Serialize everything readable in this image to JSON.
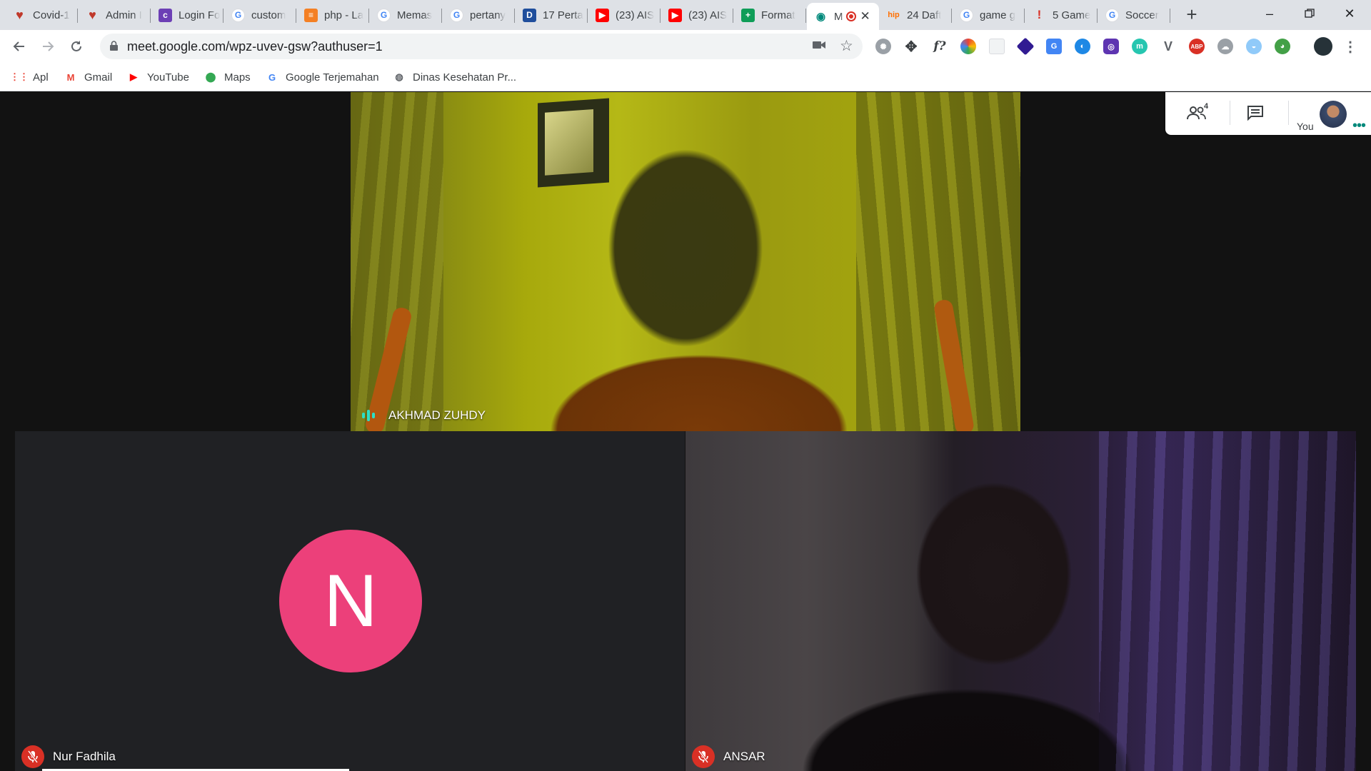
{
  "tabs": [
    {
      "title": "Covid-1",
      "icon": "heart-icon",
      "color": "#c0392b",
      "glyph": "♥"
    },
    {
      "title": "Admin I",
      "icon": "heart-icon",
      "color": "#c0392b",
      "glyph": "♥"
    },
    {
      "title": "Login Fo",
      "icon": "colorlib-icon",
      "color": "#6c3fb5",
      "glyph": "c"
    },
    {
      "title": "custom",
      "icon": "google-icon",
      "color": "#4285f4",
      "glyph": "G"
    },
    {
      "title": "php - La",
      "icon": "stackoverflow-icon",
      "color": "#f48024",
      "glyph": "≡"
    },
    {
      "title": "Memas",
      "icon": "google-icon",
      "color": "#4285f4",
      "glyph": "G"
    },
    {
      "title": "pertany",
      "icon": "google-icon",
      "color": "#4285f4",
      "glyph": "G"
    },
    {
      "title": "17 Perta",
      "icon": "d-icon",
      "color": "#1f4e9c",
      "glyph": "D"
    },
    {
      "title": "(23) AIS",
      "icon": "youtube-icon",
      "color": "#ff0000",
      "glyph": "▶"
    },
    {
      "title": "(23) AIS",
      "icon": "youtube-icon",
      "color": "#ff0000",
      "glyph": "▶"
    },
    {
      "title": "Format",
      "icon": "sheets-icon",
      "color": "#0f9d58",
      "glyph": "+"
    },
    {
      "title": "M",
      "icon": "meet-icon",
      "color": "#00897b",
      "glyph": "◉",
      "active": true
    },
    {
      "title": "24 Daft",
      "icon": "hip-icon",
      "color": "#ff6f00",
      "glyph": "hip"
    },
    {
      "title": "game g",
      "icon": "google-icon",
      "color": "#4285f4",
      "glyph": "G"
    },
    {
      "title": "5 Game",
      "icon": "exclamation-icon",
      "color": "#d93025",
      "glyph": "!"
    },
    {
      "title": "Soccer",
      "icon": "google-icon",
      "color": "#4285f4",
      "glyph": "G"
    }
  ],
  "address": {
    "url": "meet.google.com/wpz-uvev-gsw?authuser=1"
  },
  "bookmarks": [
    {
      "label": "Apl",
      "icon": "apps-grid-icon",
      "color": "#ea4335",
      "glyph": "⋮⋮"
    },
    {
      "label": "Gmail",
      "icon": "gmail-icon",
      "color": "#ea4335",
      "glyph": "M"
    },
    {
      "label": "YouTube",
      "icon": "youtube-icon",
      "color": "#ff0000",
      "glyph": "▶"
    },
    {
      "label": "Maps",
      "icon": "maps-pin-icon",
      "color": "#34a853",
      "glyph": "⬤"
    },
    {
      "label": "Google Terjemahan",
      "icon": "translate-icon",
      "color": "#4285f4",
      "glyph": "G"
    },
    {
      "label": "Dinas Kesehatan Pr...",
      "icon": "globe-icon",
      "color": "#5f6368",
      "glyph": "◍"
    }
  ],
  "participants": {
    "main": {
      "name": "AKHMAD ZUHDY",
      "speaking": true
    },
    "left": {
      "name": "Nur Fadhila",
      "initial": "N",
      "muted": true,
      "avatar_color": "#ec407a"
    },
    "right": {
      "name": "ANSAR",
      "muted": true
    }
  },
  "panel": {
    "participant_count": "4",
    "self_label": "You"
  },
  "colors": {
    "speaking_indicator": "#2be0c6",
    "muted_badge": "#d93025",
    "meet_background": "#121212"
  }
}
